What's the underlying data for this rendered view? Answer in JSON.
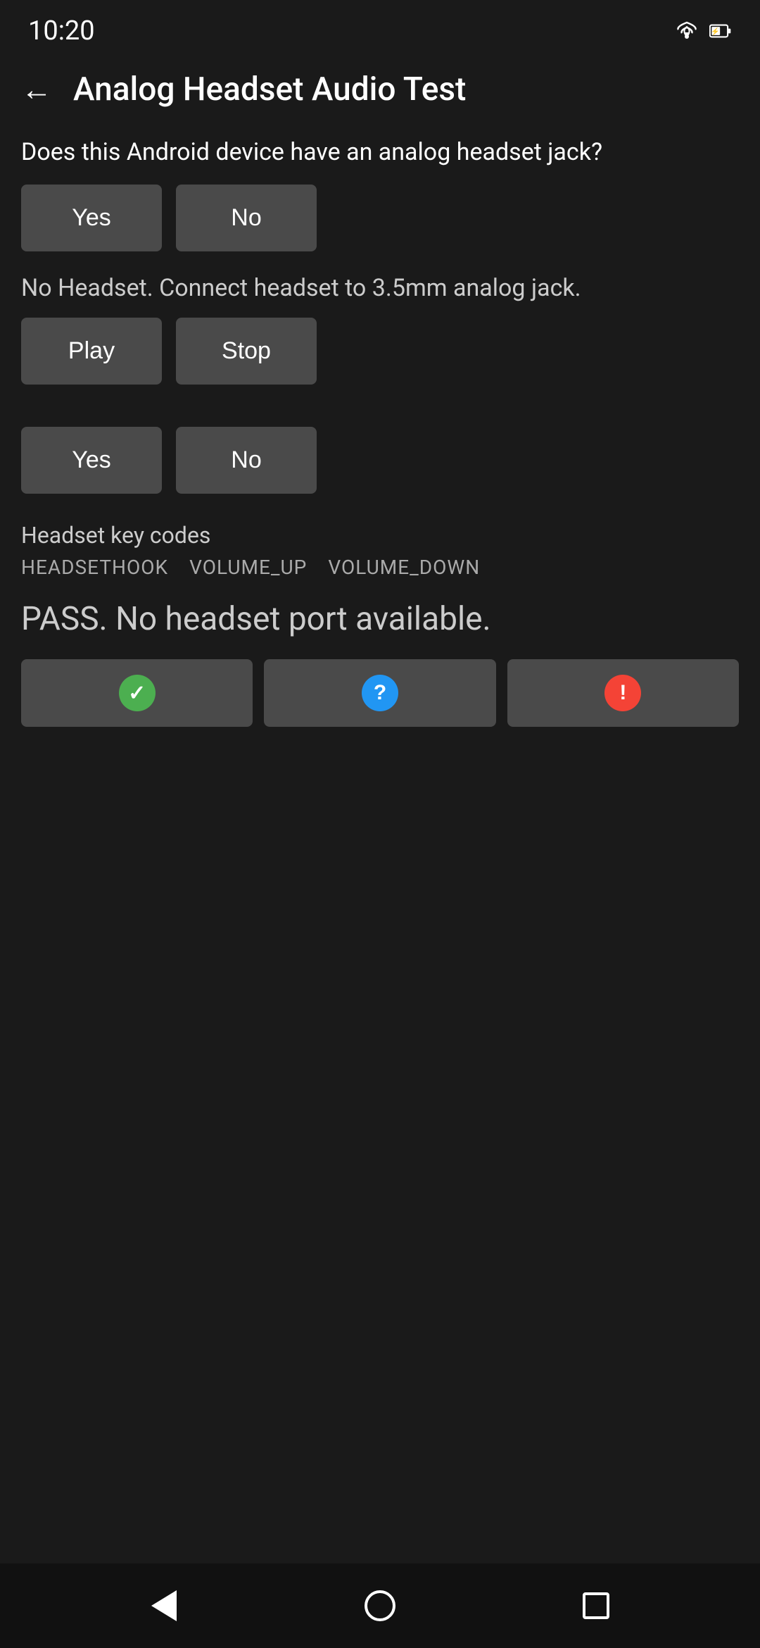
{
  "statusBar": {
    "time": "10:20",
    "wifiIcon": "wifi-icon",
    "batteryIcon": "battery-icon"
  },
  "toolbar": {
    "backLabel": "←",
    "title": "Analog Headset Audio Test"
  },
  "content": {
    "question": "Does this Android device have an analog headset jack?",
    "yesButton1": "Yes",
    "noButton1": "No",
    "infoText": "No Headset. Connect headset to 3.5mm analog jack.",
    "playButton": "Play",
    "stopButton": "Stop",
    "yesButton2": "Yes",
    "noButton2": "No",
    "keycodesLabel": "Headset key codes",
    "keycodes": [
      "HEADSETHOOK",
      "VOLUME_UP",
      "VOLUME_DOWN"
    ],
    "passText": "PASS. No headset port available.",
    "resultButtons": {
      "pass": "✓",
      "info": "?",
      "fail": "!"
    }
  },
  "navBar": {
    "back": "back",
    "home": "home",
    "recents": "recents"
  }
}
